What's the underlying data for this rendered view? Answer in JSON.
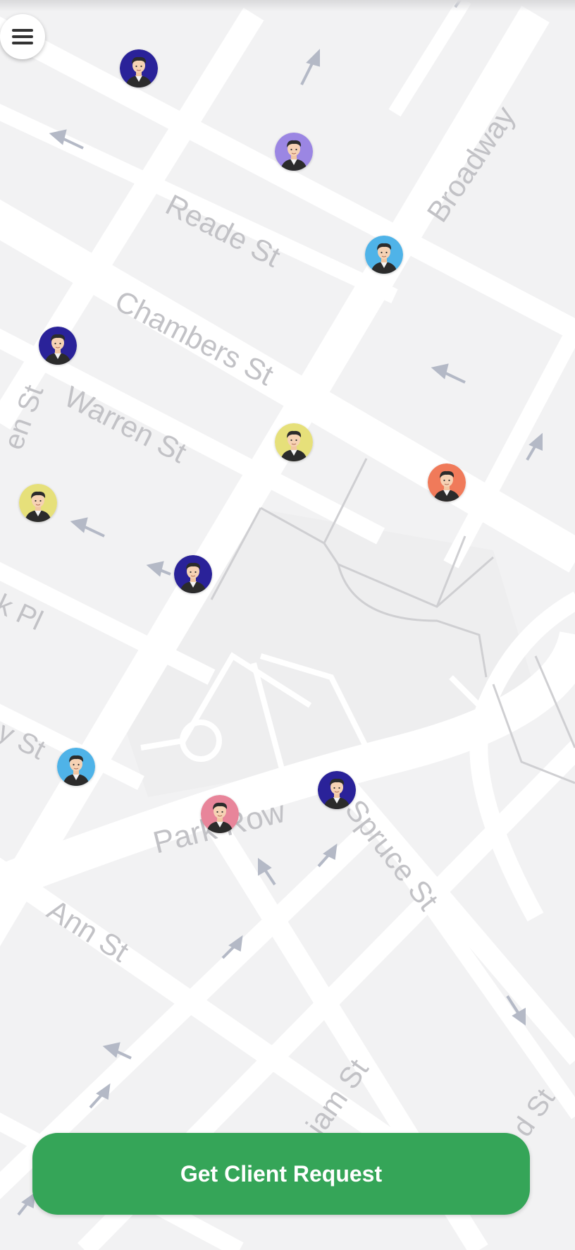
{
  "map": {
    "background_color": "#f2f2f3",
    "road_color": "#ffffff",
    "path_color": "#cfcfd2",
    "arrow_color": "#b4b9c6",
    "label_color": "#c2c2c6",
    "street_labels": {
      "broadway": "Broadway",
      "reade": "Reade St",
      "chambers": "Chambers St",
      "warren": "Warren St",
      "partial_left_st": "en St",
      "partial_pl": "k Pl",
      "partial_y_st": "y St",
      "park_row": "Park Row",
      "spruce": "Spruce St",
      "ann": "Ann St",
      "william_partial": "iam St",
      "right_partial": "d St"
    }
  },
  "menu": {
    "icon": "hamburger-menu-icon"
  },
  "driver_markers": [
    {
      "id": "driver-1",
      "bg": "#2a2299"
    },
    {
      "id": "driver-2",
      "bg": "#9b86e3"
    },
    {
      "id": "driver-3",
      "bg": "#4fb3e8"
    },
    {
      "id": "driver-4",
      "bg": "#2a2299"
    },
    {
      "id": "driver-5",
      "bg": "#e6e07a"
    },
    {
      "id": "driver-6",
      "bg": "#f07a5a"
    },
    {
      "id": "driver-7",
      "bg": "#e6e07a"
    },
    {
      "id": "driver-8",
      "bg": "#2a2299"
    },
    {
      "id": "driver-9",
      "bg": "#4fb3e8"
    },
    {
      "id": "driver-10",
      "bg": "#2a2299"
    },
    {
      "id": "driver-11",
      "bg": "#e8859a"
    }
  ],
  "cta": {
    "label": "Get Client Request",
    "color": "#35a558"
  }
}
